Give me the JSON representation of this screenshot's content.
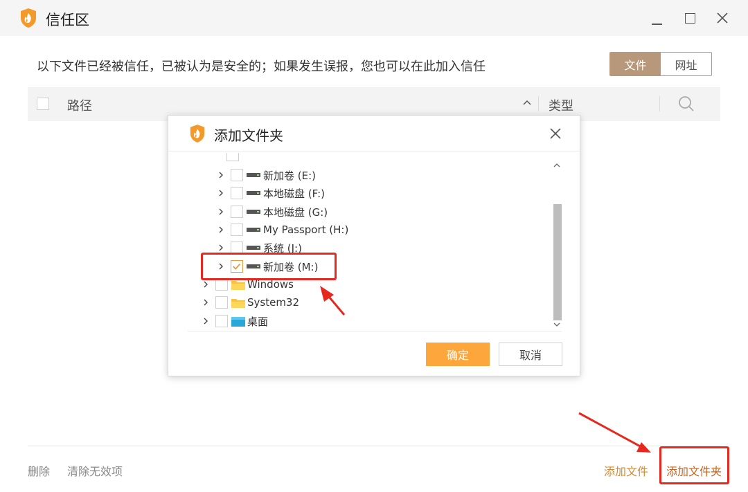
{
  "window": {
    "title": "信任区",
    "logo_icon": "shield-flame-icon",
    "min_icon": "minimize-icon",
    "max_icon": "maximize-icon",
    "close_icon": "close-icon"
  },
  "description": "以下文件已经被信任，已被认为是安全的；如果发生误报，您也可以在此加入信任",
  "segmented": {
    "active_label": "文件",
    "inactive_label": "网址"
  },
  "table": {
    "col_path": "路径",
    "col_type": "类型",
    "sort_icon": "chevron-up-icon",
    "search_icon": "search-icon"
  },
  "footer": {
    "delete_label": "删除",
    "clear_label": "清除无效项",
    "add_file_label": "添加文件",
    "add_folder_label": "添加文件夹"
  },
  "dialog": {
    "title": "添加文件夹",
    "logo_icon": "shield-flame-icon",
    "close_icon": "close-icon",
    "tree": [
      {
        "label": "新加卷 (E:)",
        "type": "drive",
        "checked": false
      },
      {
        "label": "本地磁盘 (F:)",
        "type": "drive",
        "checked": false
      },
      {
        "label": "本地磁盘 (G:)",
        "type": "drive",
        "checked": false
      },
      {
        "label": "My Passport (H:)",
        "type": "drive",
        "checked": false
      },
      {
        "label": "系统 (J:)",
        "type": "drive",
        "checked": false
      },
      {
        "label": "新加卷 (M:)",
        "type": "drive",
        "checked": true
      },
      {
        "label": "Windows",
        "type": "folder",
        "checked": false
      },
      {
        "label": "System32",
        "type": "folder",
        "checked": false
      },
      {
        "label": "桌面",
        "type": "desktop",
        "checked": false
      }
    ],
    "ok_label": "确定",
    "cancel_label": "取消"
  },
  "colors": {
    "accent_orange": "#fca63c",
    "segment_brown": "#b8987a",
    "highlight_red": "#e5291f",
    "footer_link": "#d58a2a"
  }
}
